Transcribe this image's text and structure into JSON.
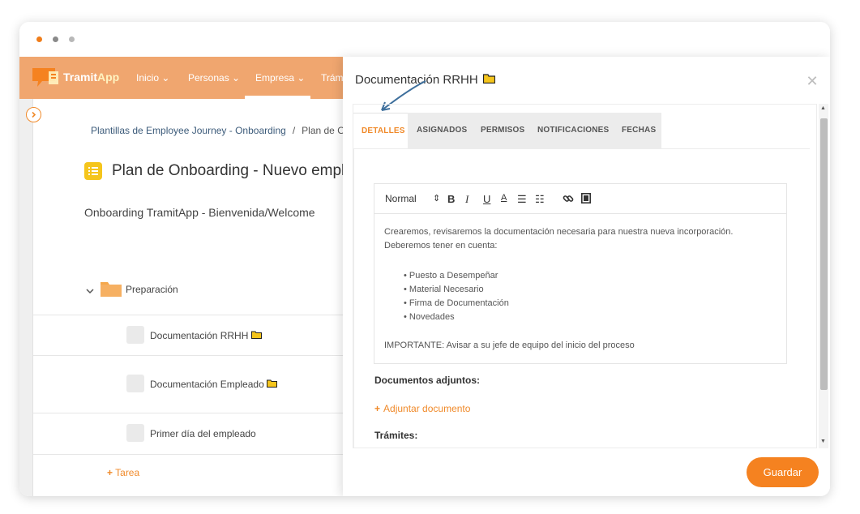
{
  "nav": {
    "logo_bold": "Tramit",
    "logo_accent": "App",
    "items": [
      "Inicio",
      "Personas",
      "Empresa",
      "Trám"
    ]
  },
  "breadcrumb": {
    "parent": "Plantillas de Employee Journey - Onboarding",
    "separator": "/",
    "current": "Plan de On"
  },
  "page": {
    "title": "Plan de Onboarding - Nuevo emplea",
    "subtitle": "Onboarding TramitApp - Bienvenida/Welcome"
  },
  "tree": {
    "folder": "Preparación",
    "tasks": [
      "Documentación RRHH",
      "Documentación Empleado",
      "Primer día del empleado"
    ],
    "add_task": "Tarea"
  },
  "modal": {
    "title": "Documentación RRHH",
    "tabs": [
      "DETALLES",
      "ASIGNADOS",
      "PERMISOS",
      "NOTIFICACIONES",
      "FECHAS"
    ],
    "editor": {
      "format": "Normal",
      "intro": "Crearemos, revisaremos la documentación necesaria para nuestra nueva incorporación. Deberemos tener en cuenta:",
      "bullets": [
        "Puesto a Desempeñar",
        "Material Necesario",
        "Firma de Documentación",
        "Novedades"
      ],
      "important": "IMPORTANTE: Avisar a su jefe de equipo del inicio del proceso"
    },
    "attachments_label": "Documentos adjuntos:",
    "attach_link": "Adjuntar documento",
    "tramites_label": "Trámites:",
    "save_label": "Guardar"
  },
  "colors": {
    "accent": "#f58220",
    "nav_bg": "#f0a66f",
    "folder": "#f5a84c"
  }
}
